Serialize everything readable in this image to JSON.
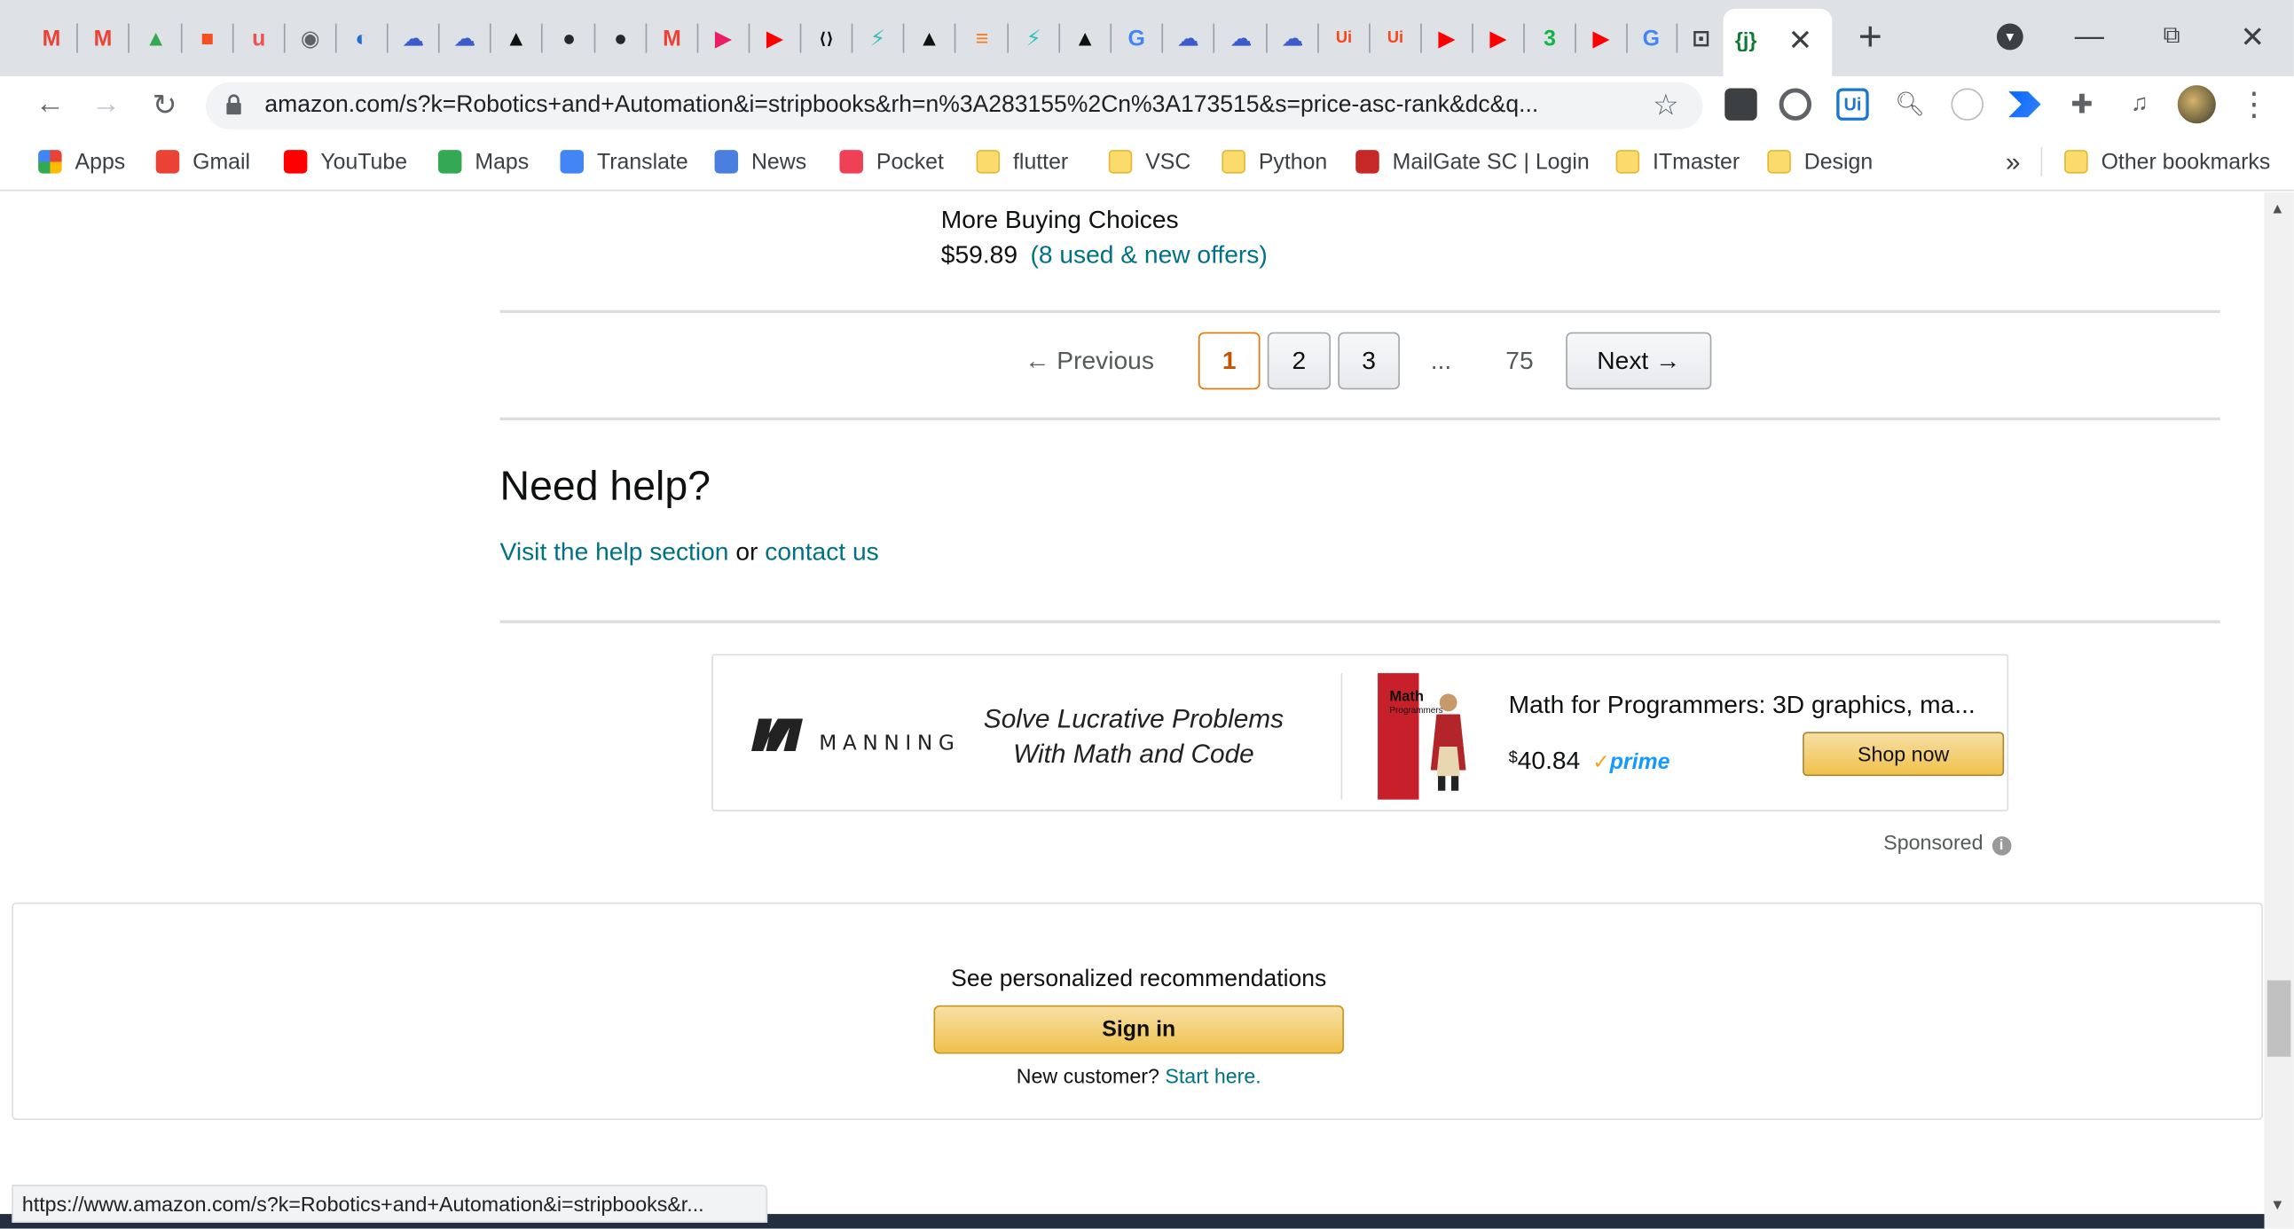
{
  "browser": {
    "url": "amazon.com/s?k=Robotics+and+Automation&i=stripbooks&rh=n%3A283155%2Cn%3A173515&s=price-asc-rank&dc&q...",
    "tabs": [
      {
        "icon": "gmail-icon",
        "color": "#ea4335",
        "glyph": "M"
      },
      {
        "icon": "gmail-icon",
        "color": "#ea4335",
        "glyph": "M"
      },
      {
        "icon": "google-drive-icon",
        "color": "#34a853",
        "glyph": "▲"
      },
      {
        "icon": "microsoft-icon",
        "color": "#f25022",
        "glyph": "■"
      },
      {
        "icon": "udemy-icon",
        "color": "#ec5252",
        "glyph": "u"
      },
      {
        "icon": "globe-icon",
        "color": "#5f6368",
        "glyph": "◉"
      },
      {
        "icon": "generic-site-icon",
        "color": "#1f6fd1",
        "glyph": "◐"
      },
      {
        "icon": "cloudflare-icon",
        "color": "#3c5ccb",
        "glyph": "☁"
      },
      {
        "icon": "cloudflare-icon",
        "color": "#3c5ccb",
        "glyph": "☁"
      },
      {
        "icon": "triangle-icon",
        "color": "#111111",
        "glyph": "▲"
      },
      {
        "icon": "github-icon",
        "color": "#24292e",
        "glyph": "●"
      },
      {
        "icon": "github-icon",
        "color": "#24292e",
        "glyph": "●"
      },
      {
        "icon": "gmail-icon",
        "color": "#ea4335",
        "glyph": "M"
      },
      {
        "icon": "media-icon",
        "color": "#e91e63",
        "glyph": "▶"
      },
      {
        "icon": "youtube-icon",
        "color": "#ff0000",
        "glyph": "▶"
      },
      {
        "icon": "code-icon",
        "color": "#111111",
        "glyph": "⟨⟩"
      },
      {
        "icon": "bolt-icon",
        "color": "#36c2b4",
        "glyph": "⚡"
      },
      {
        "icon": "triangle-icon",
        "color": "#111111",
        "glyph": "▲"
      },
      {
        "icon": "stackoverflow-icon",
        "color": "#f48024",
        "glyph": "≡"
      },
      {
        "icon": "bolt-icon",
        "color": "#36c2b4",
        "glyph": "⚡"
      },
      {
        "icon": "triangle-icon",
        "color": "#111111",
        "glyph": "▲"
      },
      {
        "icon": "google-icon",
        "color": "#4285f4",
        "glyph": "G"
      },
      {
        "icon": "cloudflare-icon",
        "color": "#3c5ccb",
        "glyph": "☁"
      },
      {
        "icon": "cloudflare-icon",
        "color": "#3c5ccb",
        "glyph": "☁"
      },
      {
        "icon": "cloudflare-icon",
        "color": "#3c5ccb",
        "glyph": "☁"
      },
      {
        "icon": "uipath-icon",
        "color": "#fa4616",
        "glyph": "Ui"
      },
      {
        "icon": "uipath-icon",
        "color": "#fa4616",
        "glyph": "Ui"
      },
      {
        "icon": "youtube-icon",
        "color": "#ff0000",
        "glyph": "▶"
      },
      {
        "icon": "youtube-icon",
        "color": "#ff0000",
        "glyph": "▶"
      },
      {
        "icon": "badge-icon",
        "color": "#12b347",
        "glyph": "3"
      },
      {
        "icon": "youtube-icon",
        "color": "#ff0000",
        "glyph": "▶"
      },
      {
        "icon": "google-icon",
        "color": "#4285f4",
        "glyph": "G"
      },
      {
        "icon": "robot-icon",
        "color": "#3c4043",
        "glyph": "⊡"
      },
      {
        "icon": "json-icon",
        "color": "#0b7a35",
        "glyph": "{j}"
      }
    ],
    "bookmarks": [
      {
        "label": "Apps",
        "icon": "apps-grid-icon"
      },
      {
        "label": "Gmail",
        "icon": "gmail-icon"
      },
      {
        "label": "YouTube",
        "icon": "youtube-icon"
      },
      {
        "label": "Maps",
        "icon": "maps-pin-icon"
      },
      {
        "label": "Translate",
        "icon": "translate-icon"
      },
      {
        "label": "News",
        "icon": "news-icon"
      },
      {
        "label": "Pocket",
        "icon": "pocket-icon"
      },
      {
        "label": "flutter",
        "icon": "folder-icon"
      },
      {
        "label": "VSC",
        "icon": "folder-icon"
      },
      {
        "label": "Python",
        "icon": "folder-icon"
      },
      {
        "label": "MailGate SC | Login",
        "icon": "mailgate-icon"
      },
      {
        "label": "ITmaster",
        "icon": "folder-icon"
      },
      {
        "label": "Design",
        "icon": "folder-icon"
      }
    ],
    "more_bookmarks": "»",
    "other_bookmarks": "Other bookmarks",
    "status_url": "https://www.amazon.com/s?k=Robotics+and+Automation&i=stripbooks&r..."
  },
  "results_tail": {
    "more_buying_choices": "More Buying Choices",
    "price": "$59.89",
    "offers_link": "(8 used & new offers)"
  },
  "pagination": {
    "previous": "← Previous",
    "pages": [
      "1",
      "2",
      "3"
    ],
    "current": "1",
    "ellipsis": "...",
    "last": "75",
    "next": "Next →"
  },
  "help": {
    "title": "Need help?",
    "help_link": "Visit the help section",
    "or": "or",
    "contact_link": "contact us"
  },
  "ad": {
    "brand": "MANNING",
    "tagline_1": "Solve Lucrative Problems",
    "tagline_2": "With Math and Code",
    "book_cover_title": "Math",
    "book_cover_subtitle": "Programmers",
    "product_title": "Math for Programmers: 3D graphics, ma...",
    "price_symbol": "$",
    "price": "40.84",
    "prime": "prime",
    "shop_button": "Shop now",
    "sponsored": "Sponsored"
  },
  "recommendations": {
    "heading": "See personalized recommendations",
    "signin": "Sign in",
    "new_customer": "New customer?",
    "start_here": "Start here."
  }
}
